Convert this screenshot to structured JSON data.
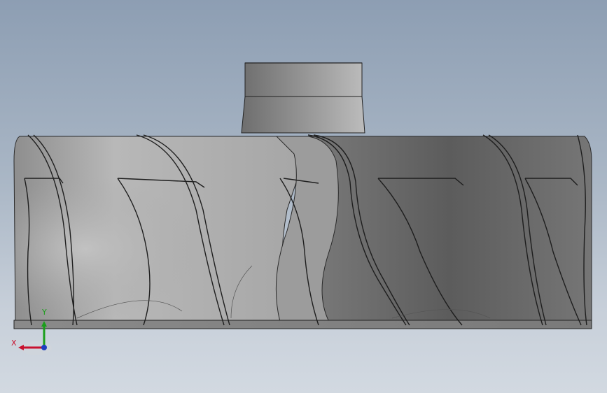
{
  "viewport": {
    "background_top": "#8d9eb3",
    "background_bottom": "#d2d9e1",
    "model": "impeller-part",
    "model_color_light": "#b4b4b4",
    "model_color_dark": "#5e5e5e"
  },
  "triad": {
    "x_label": "X",
    "y_label": "Y",
    "x_color": "#c8102e",
    "y_color": "#1a9e1a",
    "z_color": "#1f3fbf"
  }
}
